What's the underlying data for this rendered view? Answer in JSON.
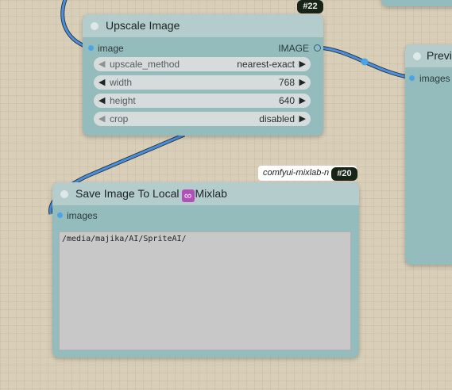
{
  "nodes": {
    "upscale": {
      "title": "Upscale Image",
      "id_badge": "#22",
      "input_label": "image",
      "output_label": "IMAGE",
      "widgets": [
        {
          "label": "upscale_method",
          "value": "nearest-exact"
        },
        {
          "label": "width",
          "value": "768"
        },
        {
          "label": "height",
          "value": "640"
        },
        {
          "label": "crop",
          "value": "disabled"
        }
      ]
    },
    "save": {
      "title": "Save Image To Local",
      "title_suffix": "Mixlab",
      "id_badge": "#20",
      "source_label": "comfyui-mixlab-n",
      "input_label": "images",
      "path_value": "/media/majika/AI/SpriteAI/"
    },
    "preview": {
      "title": "Previ",
      "input_label": "images"
    }
  },
  "icons": {
    "collapse": "circle-dot-icon",
    "arrow_left": "triangle-left-icon",
    "arrow_right": "triangle-right-icon",
    "mixlab": "infinity-icon"
  },
  "colors": {
    "canvas": "#d9cfb9",
    "node_body": "#95bcbd",
    "node_header": "#b4cccb",
    "link": "#4a90e2",
    "badge": "#172417"
  }
}
